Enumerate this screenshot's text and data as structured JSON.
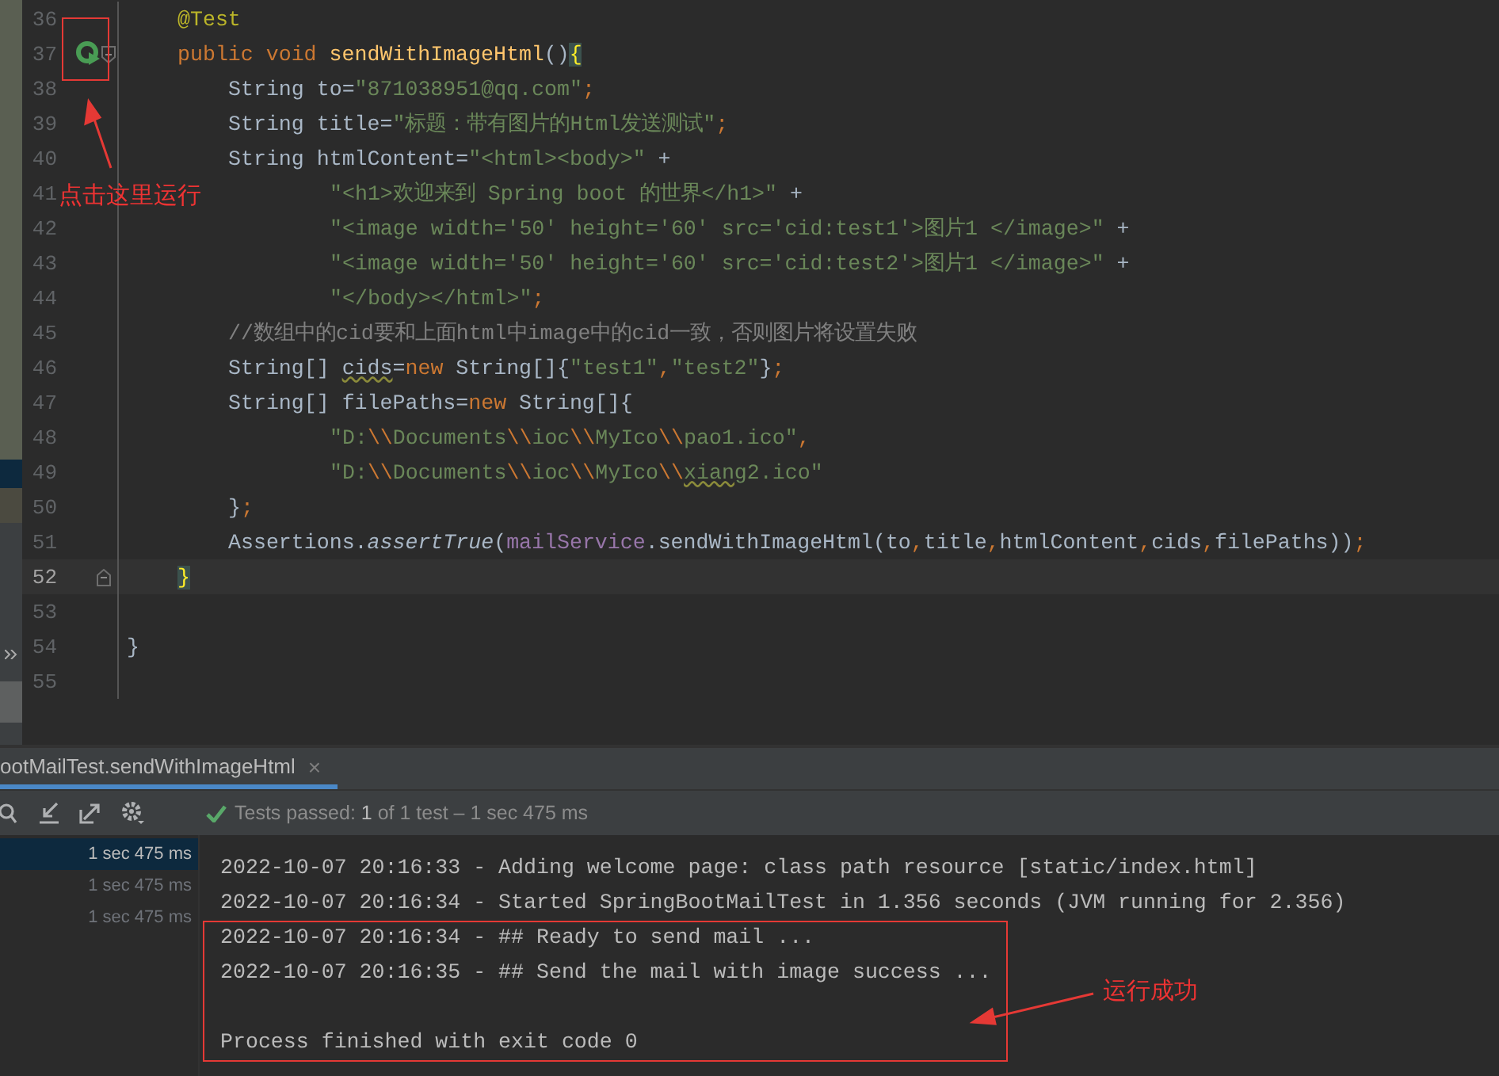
{
  "editor": {
    "method_lines": [
      {
        "number": "36",
        "current": false,
        "run_button": false,
        "fold_start": false,
        "fold_end": false,
        "tokens": [
          {
            "kind": "ann",
            "text": "@Test"
          }
        ]
      },
      {
        "number": "37",
        "current": false,
        "run_button": true,
        "fold_start": true,
        "fold_end": false,
        "tokens": [
          {
            "kind": "kw",
            "text": "public void "
          },
          {
            "kind": "fn",
            "text": "sendWithImageHtml"
          },
          {
            "kind": "plain",
            "text": "()"
          },
          {
            "kind": "brace",
            "text": "{"
          }
        ],
        "children": [
          {
            "number": "38",
            "current": false,
            "run_button": false,
            "fold_start": false,
            "fold_end": false,
            "tokens": [
              {
                "kind": "plain",
                "text": "String to="
              },
              {
                "kind": "str",
                "text": "\"871038951@qq.com\""
              },
              {
                "kind": "kw",
                "text": ";"
              }
            ]
          },
          {
            "number": "39",
            "current": false,
            "run_button": false,
            "fold_start": false,
            "fold_end": false,
            "tokens": [
              {
                "kind": "plain",
                "text": "String title="
              },
              {
                "kind": "str",
                "text": "\"标题：带有图片的Html发送测试\""
              },
              {
                "kind": "kw",
                "text": ";"
              }
            ]
          },
          {
            "number": "40",
            "current": false,
            "run_button": false,
            "fold_start": false,
            "fold_end": false,
            "tokens": [
              {
                "kind": "plain",
                "text": "String htmlContent="
              },
              {
                "kind": "str",
                "text": "\"<html><body>\""
              },
              {
                "kind": "plain",
                "text": " +"
              }
            ],
            "children": [
              {
                "number": "41",
                "current": false,
                "run_button": false,
                "fold_start": false,
                "fold_end": false,
                "tokens": [
                  {
                    "kind": "str",
                    "text": "\"<h1>欢迎来到 Spring boot 的世界</h1>\""
                  },
                  {
                    "kind": "plain",
                    "text": " +"
                  }
                ]
              },
              {
                "number": "42",
                "current": false,
                "run_button": false,
                "fold_start": false,
                "fold_end": false,
                "tokens": [
                  {
                    "kind": "str",
                    "text": "\"<image width='50' height='60' src='cid:test1'>图片1 </image>\""
                  },
                  {
                    "kind": "plain",
                    "text": " +"
                  }
                ]
              },
              {
                "number": "43",
                "current": false,
                "run_button": false,
                "fold_start": false,
                "fold_end": false,
                "tokens": [
                  {
                    "kind": "str",
                    "text": "\"<image width='50' height='60' src='cid:test2'>图片1 </image>\""
                  },
                  {
                    "kind": "plain",
                    "text": " +"
                  }
                ]
              },
              {
                "number": "44",
                "current": false,
                "run_button": false,
                "fold_start": false,
                "fold_end": false,
                "tokens": [
                  {
                    "kind": "str",
                    "text": "\"</body></html>\""
                  },
                  {
                    "kind": "kw",
                    "text": ";"
                  }
                ]
              }
            ]
          },
          {
            "number": "45",
            "current": false,
            "run_button": false,
            "fold_start": false,
            "fold_end": false,
            "tokens": [
              {
                "kind": "comment",
                "text": "//数组中的cid要和上面html中image中的cid一致，否则图片将设置失败"
              }
            ]
          },
          {
            "number": "46",
            "current": false,
            "run_button": false,
            "fold_start": false,
            "fold_end": false,
            "tokens": [
              {
                "kind": "plain",
                "text": "String[] "
              },
              {
                "kind": "warn",
                "text": "cids"
              },
              {
                "kind": "plain",
                "text": "="
              },
              {
                "kind": "kw",
                "text": "new "
              },
              {
                "kind": "plain",
                "text": "String[]{"
              },
              {
                "kind": "str",
                "text": "\"test1\""
              },
              {
                "kind": "kw",
                "text": ","
              },
              {
                "kind": "str",
                "text": "\"test2\""
              },
              {
                "kind": "plain",
                "text": "}"
              },
              {
                "kind": "kw",
                "text": ";"
              }
            ]
          },
          {
            "number": "47",
            "current": false,
            "run_button": false,
            "fold_start": false,
            "fold_end": false,
            "tokens": [
              {
                "kind": "plain",
                "text": "String[] filePaths="
              },
              {
                "kind": "kw",
                "text": "new "
              },
              {
                "kind": "plain",
                "text": "String[]{"
              }
            ],
            "children": [
              {
                "number": "48",
                "current": false,
                "run_button": false,
                "fold_start": false,
                "fold_end": false,
                "tokens": [
                  {
                    "kind": "str",
                    "text": "\"D:"
                  },
                  {
                    "kind": "kw",
                    "text": "\\\\"
                  },
                  {
                    "kind": "str",
                    "text": "Documents"
                  },
                  {
                    "kind": "kw",
                    "text": "\\\\"
                  },
                  {
                    "kind": "str",
                    "text": "ioc"
                  },
                  {
                    "kind": "kw",
                    "text": "\\\\"
                  },
                  {
                    "kind": "str",
                    "text": "MyIco"
                  },
                  {
                    "kind": "kw",
                    "text": "\\\\"
                  },
                  {
                    "kind": "str",
                    "text": "pao1.ico\""
                  },
                  {
                    "kind": "kw",
                    "text": ","
                  }
                ]
              },
              {
                "number": "49",
                "current": false,
                "run_button": false,
                "fold_start": false,
                "fold_end": false,
                "tokens": [
                  {
                    "kind": "str",
                    "text": "\"D:"
                  },
                  {
                    "kind": "kw",
                    "text": "\\\\"
                  },
                  {
                    "kind": "str",
                    "text": "Documents"
                  },
                  {
                    "kind": "kw",
                    "text": "\\\\"
                  },
                  {
                    "kind": "str",
                    "text": "ioc"
                  },
                  {
                    "kind": "kw",
                    "text": "\\\\"
                  },
                  {
                    "kind": "str",
                    "text": "MyIco"
                  },
                  {
                    "kind": "kw",
                    "text": "\\\\"
                  },
                  {
                    "kind": "warnstr",
                    "text": "xiang"
                  },
                  {
                    "kind": "str",
                    "text": "2.ico\""
                  }
                ]
              }
            ]
          },
          {
            "number": "50",
            "current": false,
            "run_button": false,
            "fold_start": false,
            "fold_end": false,
            "tokens": [
              {
                "kind": "plain",
                "text": "}"
              },
              {
                "kind": "kw",
                "text": ";"
              }
            ]
          },
          {
            "number": "51",
            "current": false,
            "run_button": false,
            "fold_start": false,
            "fold_end": false,
            "tokens": [
              {
                "kind": "plain",
                "text": "Assertions."
              },
              {
                "kind": "italic",
                "text": "assertTrue"
              },
              {
                "kind": "plain",
                "text": "("
              },
              {
                "kind": "field",
                "text": "mailService"
              },
              {
                "kind": "plain",
                "text": ".sendWithImageHtml(to"
              },
              {
                "kind": "kw",
                "text": ","
              },
              {
                "kind": "plain",
                "text": "title"
              },
              {
                "kind": "kw",
                "text": ","
              },
              {
                "kind": "plain",
                "text": "htmlContent"
              },
              {
                "kind": "kw",
                "text": ","
              },
              {
                "kind": "plain",
                "text": "cids"
              },
              {
                "kind": "kw",
                "text": ","
              },
              {
                "kind": "plain",
                "text": "filePaths))"
              },
              {
                "kind": "kw",
                "text": ";"
              }
            ]
          }
        ]
      },
      {
        "number": "52",
        "current": true,
        "run_button": false,
        "fold_start": false,
        "fold_end": true,
        "tokens": [
          {
            "kind": "brace",
            "text": "}"
          }
        ]
      }
    ],
    "class_end_lines": [
      {
        "number": "53",
        "current": false,
        "run_button": false,
        "fold_start": false,
        "fold_end": false
      },
      {
        "number": "54",
        "current": false,
        "run_button": false,
        "fold_start": false,
        "fold_end": false,
        "tokens": [
          {
            "kind": "plain",
            "text": "}"
          }
        ]
      },
      {
        "number": "55",
        "current": false,
        "run_button": false,
        "fold_start": false,
        "fold_end": false
      }
    ]
  },
  "run_panel": {
    "tab": {
      "title": "ootMailTest.sendWithImageHtml",
      "close": "×"
    },
    "status": "Tests passed: **1** of 1 test – 1 sec 475 ms",
    "tree": [
      {
        "time": "1 sec 475 ms",
        "selected": true
      },
      {
        "time": "1 sec 475 ms",
        "selected": false
      },
      {
        "time": "1 sec 475 ms",
        "selected": false
      }
    ],
    "console": [
      "2022-10-07 20:16:33 - Adding welcome page: class path resource [static/index.html]",
      "2022-10-07 20:16:34 - Started SpringBootMailTest in 1.356 seconds (JVM running for 2.356)",
      "2022-10-07 20:16:34 - ## Ready to send mail ...",
      "2022-10-07 20:16:35 - ## Send the mail with image success ..."
    ],
    "exit_message": "Process finished with exit code 0"
  },
  "annotations": [
    {
      "text": "点击这里运行"
    },
    {
      "text": "运行成功"
    }
  ]
}
